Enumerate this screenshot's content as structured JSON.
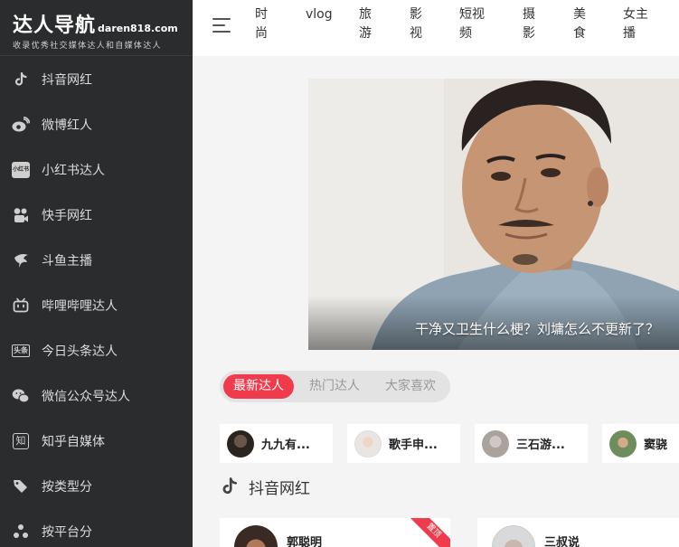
{
  "logo": {
    "title": "达人导航",
    "domain": "daren818.com",
    "slogan": "收录优秀社交媒体达人和自媒体达人"
  },
  "sidebar": {
    "items": [
      {
        "label": "抖音网红",
        "icon": "tiktok-icon"
      },
      {
        "label": "微博红人",
        "icon": "weibo-icon"
      },
      {
        "label": "小红书达人",
        "icon": "xiaohongshu-icon",
        "icon_text": "小红书"
      },
      {
        "label": "快手网红",
        "icon": "kuaishou-icon"
      },
      {
        "label": "斗鱼主播",
        "icon": "douyu-icon"
      },
      {
        "label": "哔哩哔哩达人",
        "icon": "bilibili-icon"
      },
      {
        "label": "今日头条达人",
        "icon": "toutiao-icon",
        "icon_text": "头条"
      },
      {
        "label": "微信公众号达人",
        "icon": "wechat-icon"
      },
      {
        "label": "知乎自媒体",
        "icon": "zhihu-icon",
        "icon_text": "知"
      },
      {
        "label": "按类型分",
        "icon": "tag-icon"
      },
      {
        "label": "按平台分",
        "icon": "platform-icon"
      }
    ]
  },
  "topbar": {
    "categories": [
      {
        "label": "时\n尚"
      },
      {
        "label": "vlog"
      },
      {
        "label": "旅\n游"
      },
      {
        "label": "影\n视"
      },
      {
        "label": "短视\n频"
      },
      {
        "label": "摄\n影"
      },
      {
        "label": "美\n食"
      },
      {
        "label": "女主\n播"
      }
    ]
  },
  "banner": {
    "caption": "干净又卫生什么梗？刘墉怎么不更新了？"
  },
  "tabs": [
    {
      "label": "最新达人",
      "active": true
    },
    {
      "label": "热门达人",
      "active": false
    },
    {
      "label": "大家喜欢",
      "active": false
    }
  ],
  "person_cards": [
    {
      "name": "九九有..."
    },
    {
      "name": "歌手申..."
    },
    {
      "name": "三石游..."
    },
    {
      "name": "窦骁"
    }
  ],
  "section": {
    "title": "抖音网红",
    "icon": "tiktok-icon"
  },
  "bottom_cards": [
    {
      "name": "郭聪明",
      "ribbon": "置顶"
    },
    {
      "name": "三叔说"
    }
  ],
  "colors": {
    "sidebar_bg": "#2b2c2e",
    "accent": "#ef3b4b",
    "page_bg": "#f4f4f4"
  }
}
